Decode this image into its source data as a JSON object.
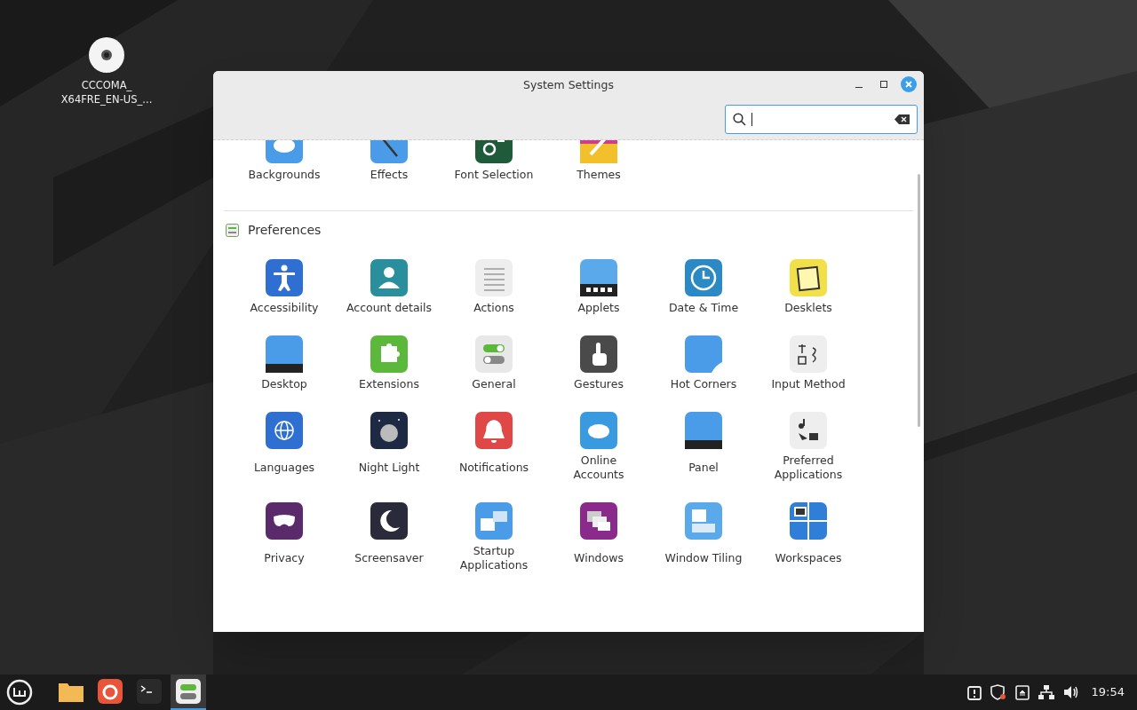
{
  "desktop_icons": [
    {
      "label": "CCCOMA_\nX64FRE_EN-US_..."
    }
  ],
  "window": {
    "title": "System Settings",
    "search": {
      "focused": true
    }
  },
  "sections": [
    {
      "items": [
        {
          "label": "Backgrounds"
        },
        {
          "label": "Effects"
        },
        {
          "label": "Font Selection"
        },
        {
          "label": "Themes"
        }
      ]
    },
    {
      "title": "Preferences",
      "items": [
        {
          "label": "Accessibility"
        },
        {
          "label": "Account details"
        },
        {
          "label": "Actions"
        },
        {
          "label": "Applets"
        },
        {
          "label": "Date & Time"
        },
        {
          "label": "Desklets"
        },
        {
          "label": "Desktop"
        },
        {
          "label": "Extensions"
        },
        {
          "label": "General"
        },
        {
          "label": "Gestures"
        },
        {
          "label": "Hot Corners"
        },
        {
          "label": "Input Method"
        },
        {
          "label": "Languages"
        },
        {
          "label": "Night Light"
        },
        {
          "label": "Notifications"
        },
        {
          "label": "Online\nAccounts"
        },
        {
          "label": "Panel"
        },
        {
          "label": "Preferred\nApplications"
        },
        {
          "label": "Privacy"
        },
        {
          "label": "Screensaver"
        },
        {
          "label": "Startup\nApplications"
        },
        {
          "label": "Windows"
        },
        {
          "label": "Window Tiling"
        },
        {
          "label": "Workspaces"
        }
      ]
    }
  ],
  "taskbar": {
    "apps": [
      {
        "selected": false
      },
      {
        "selected": false
      },
      {
        "selected": false
      },
      {
        "selected": true
      }
    ],
    "clock": "19:54"
  }
}
